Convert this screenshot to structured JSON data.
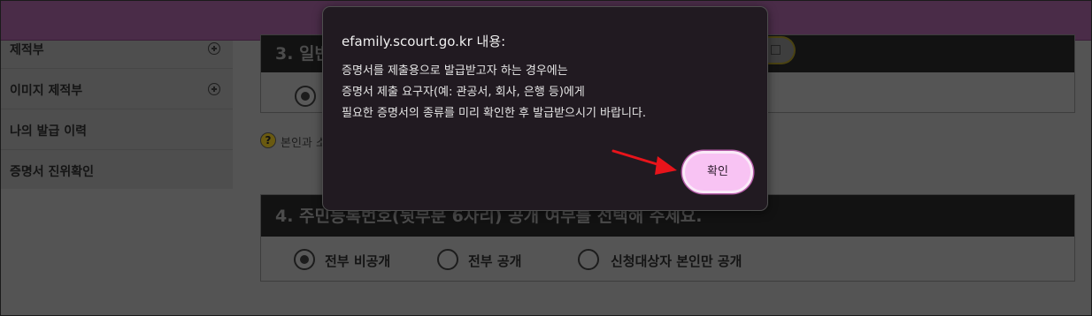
{
  "sidebar": {
    "items": [
      {
        "label": "제적부"
      },
      {
        "label": "이미지 제적부"
      },
      {
        "label": "나의 발급 이력"
      },
      {
        "label": "증명서 진위확인"
      }
    ]
  },
  "section3": {
    "title": "3. 일반"
  },
  "help": {
    "icon_char": "?",
    "text": "본인과 소"
  },
  "section4": {
    "title": "4. 주민등록번호(뒷부분 6자리) 공개 여부를 선택해 주세요.",
    "options": [
      {
        "label": "전부 비공개",
        "checked": true
      },
      {
        "label": "전부 공개",
        "checked": false
      },
      {
        "label": "신청대상자 본인만 공개",
        "checked": false
      }
    ]
  },
  "dialog": {
    "title": "efamily.scourt.go.kr 내용:",
    "message_lines": [
      "증명서를 제출용으로 발급받고자 하는 경우에는",
      "증명서 제출 요구자(예: 관공서, 회사, 은행 등)에게",
      "필요한 증명서의 종류를 미리 확인한 후 발급받으시기 바랍니다."
    ],
    "ok_label": "확인"
  },
  "colors": {
    "dialog_background": "#211a21",
    "ok_button": "#f8c3f3",
    "annotation_arrow": "#e8141b",
    "header_bar": "#4a2c48"
  },
  "icons": {
    "expand": "plus-circle-icon",
    "help": "question-circle-icon",
    "external": "external-link-icon",
    "annotation": "red-arrow"
  }
}
